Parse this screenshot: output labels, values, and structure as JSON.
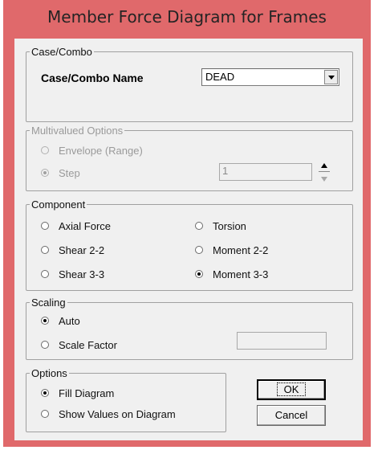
{
  "window": {
    "title": "Member Force Diagram for Frames",
    "frame_color": "#e0696b"
  },
  "case_combo": {
    "group_label": "Case/Combo",
    "name_label": "Case/Combo Name",
    "selected": "DEAD"
  },
  "multivalued": {
    "group_label": "Multivalued Options",
    "envelope_label": "Envelope (Range)",
    "step_label": "Step",
    "step_value": "1"
  },
  "component": {
    "group_label": "Component",
    "axial_force": "Axial Force",
    "torsion": "Torsion",
    "shear_22": "Shear 2-2",
    "moment_22": "Moment 2-2",
    "shear_33": "Shear 3-3",
    "moment_33": "Moment 3-3",
    "selected": "Moment 3-3"
  },
  "scaling": {
    "group_label": "Scaling",
    "auto": "Auto",
    "scale_factor": "Scale Factor",
    "scale_value": ""
  },
  "options": {
    "group_label": "Options",
    "fill_diagram": "Fill Diagram",
    "show_values": "Show Values on Diagram"
  },
  "buttons": {
    "ok": "OK",
    "cancel": "Cancel"
  }
}
